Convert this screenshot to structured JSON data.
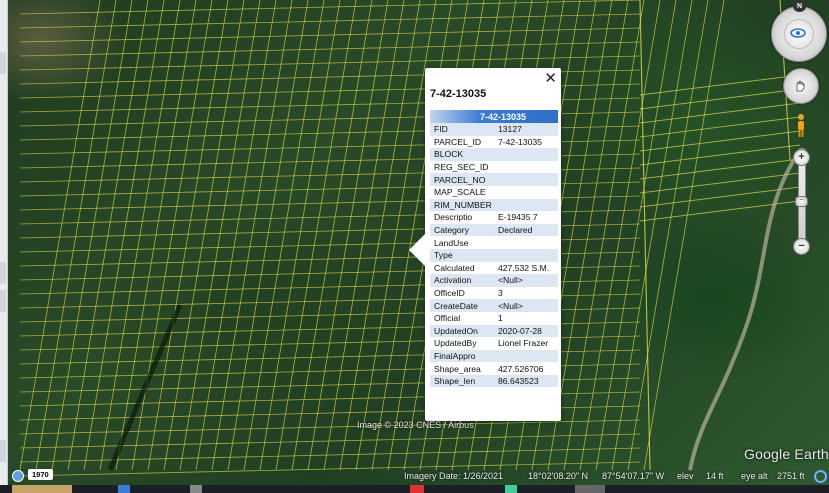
{
  "map": {
    "credit": "Image © 2023 CNES / Airbus",
    "logo": "Google Earth"
  },
  "popup": {
    "title": "7-42-13035",
    "table_header": "7-42-13035",
    "rows": [
      {
        "field": "FID",
        "value": "13127"
      },
      {
        "field": "PARCEL_ID",
        "value": "7-42-13035"
      },
      {
        "field": "BLOCK",
        "value": ""
      },
      {
        "field": "REG_SEC_ID",
        "value": ""
      },
      {
        "field": "PARCEL_NO",
        "value": ""
      },
      {
        "field": "MAP_SCALE",
        "value": ""
      },
      {
        "field": "RIM_NUMBER",
        "value": ""
      },
      {
        "field": "Descriptio",
        "value": "E-19435 7"
      },
      {
        "field": "Category",
        "value": "Declared"
      },
      {
        "field": "LandUse",
        "value": ""
      },
      {
        "field": "Type",
        "value": ""
      },
      {
        "field": "Calculated",
        "value": "427.532 S.M."
      },
      {
        "field": "Activation",
        "value": "<Null>"
      },
      {
        "field": "OfficeID",
        "value": "3"
      },
      {
        "field": "CreateDate",
        "value": "<Null>"
      },
      {
        "field": "Official",
        "value": "1"
      },
      {
        "field": "UpdatedOn",
        "value": "2020-07-28"
      },
      {
        "field": "UpdatedBy",
        "value": "Lionel Frazer"
      },
      {
        "field": "FinalAppro",
        "value": ""
      },
      {
        "field": "Shape_area",
        "value": "427.526706"
      },
      {
        "field": "Shape_len",
        "value": "86.643523"
      }
    ]
  },
  "navigation": {
    "compass_north": "N"
  },
  "status_bar": {
    "historical_year": "1970",
    "imagery_date": "Imagery Date: 1/26/2021",
    "latitude": "18°02'08.20\" N",
    "longitude": "87°54'07.17\" W",
    "elev_label": "elev",
    "elev_value": "14 ft",
    "eye_alt_label": "eye alt",
    "eye_alt_value": "2751 ft"
  },
  "colors": {
    "parcel_lines": "#d8d84a",
    "table_header": "#2f6fc8",
    "alt_row": "#dde7f4"
  },
  "icons": {
    "close": "close-icon",
    "pegman": "pegman-icon",
    "compass": "compass-icon",
    "look": "look-joystick-icon"
  }
}
